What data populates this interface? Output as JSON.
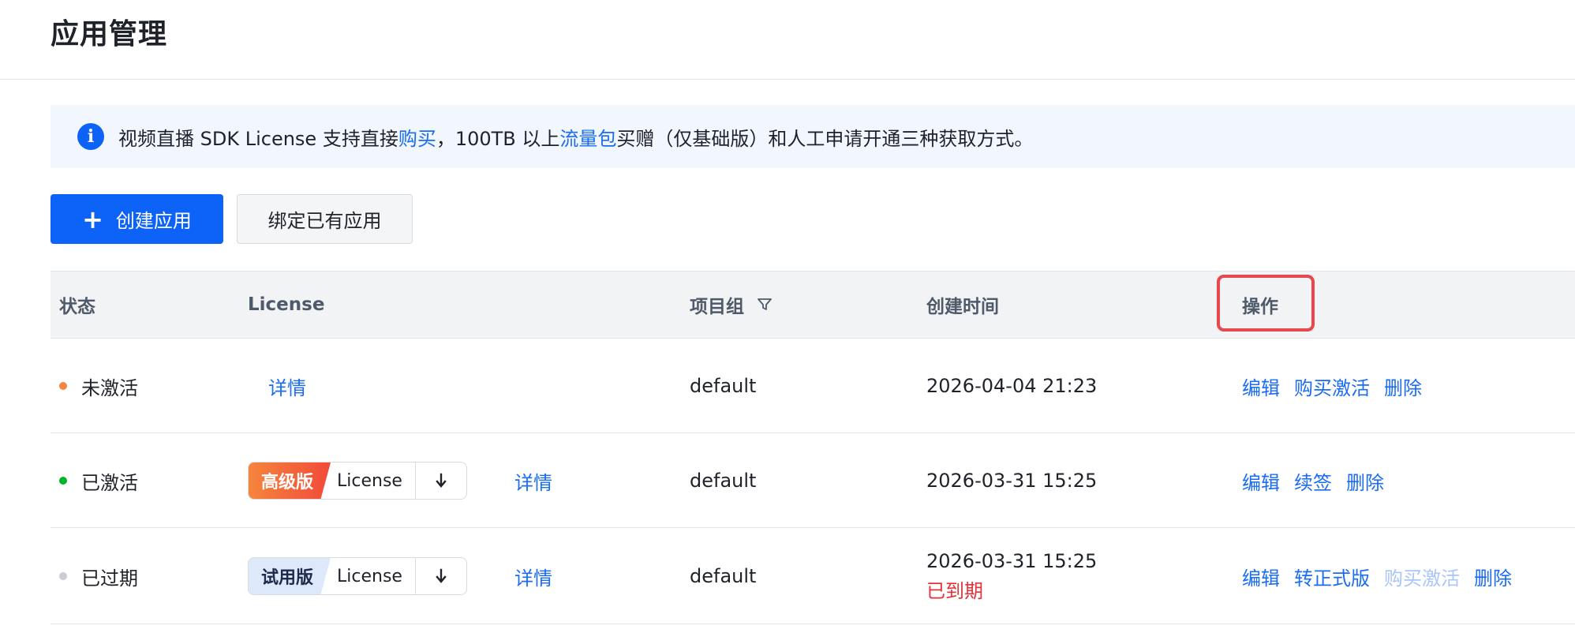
{
  "page": {
    "title": "应用管理"
  },
  "notice": {
    "text_1": "视频直播 SDK License 支持直接",
    "link_buy": "购买",
    "text_2": "，100TB 以上",
    "link_traffic": "流量包",
    "text_3": "买赠（仅基础版）和人工申请开通三种获取方式。"
  },
  "toolbar": {
    "create_label": "创建应用",
    "bind_label": "绑定已有应用"
  },
  "table": {
    "headers": {
      "status": "状态",
      "license": "License",
      "project": "项目组",
      "created": "创建时间",
      "actions": "操作"
    },
    "rows": [
      {
        "status": "未激活",
        "status_color": "#f5853d",
        "detail": "详情",
        "project": "default",
        "created": "2026-04-04 21:23",
        "actions": {
          "edit": "编辑",
          "buy_activate": "购买激活",
          "delete": "删除"
        }
      },
      {
        "status": "已激活",
        "status_color": "#00b42a",
        "edition": "高级版",
        "license_label": "License",
        "detail": "详情",
        "project": "default",
        "created": "2026-03-31 15:25",
        "actions": {
          "edit": "编辑",
          "renew": "续签",
          "delete": "删除"
        }
      },
      {
        "status": "已过期",
        "status_color": "#c9cdd4",
        "edition": "试用版",
        "license_label": "License",
        "detail": "详情",
        "project": "default",
        "created": "2026-03-31 15:25",
        "expired_note": "已到期",
        "actions": {
          "edit": "编辑",
          "convert": "转正式版",
          "buy_activate": "购买激活",
          "delete": "删除"
        }
      }
    ]
  },
  "colors": {
    "primary": "#0d62f7",
    "link": "#1a6cf3",
    "danger": "#e5323a",
    "highlight": "#e5484d"
  }
}
